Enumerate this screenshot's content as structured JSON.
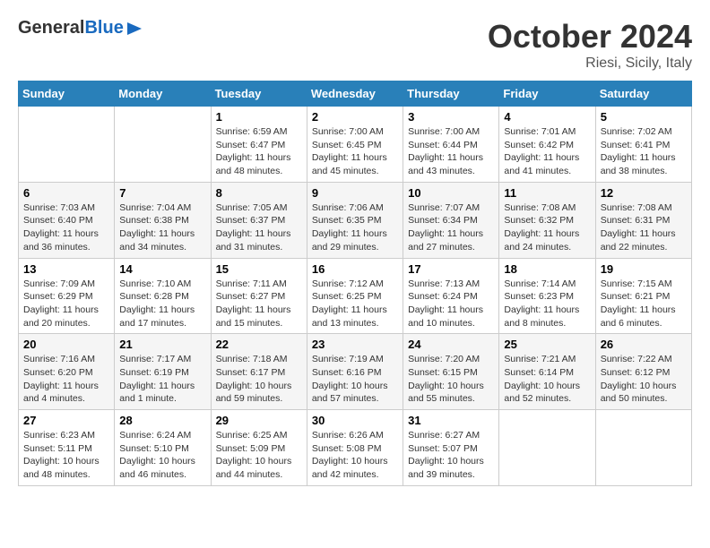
{
  "header": {
    "logo_general": "General",
    "logo_blue": "Blue",
    "month": "October 2024",
    "location": "Riesi, Sicily, Italy"
  },
  "weekdays": [
    "Sunday",
    "Monday",
    "Tuesday",
    "Wednesday",
    "Thursday",
    "Friday",
    "Saturday"
  ],
  "weeks": [
    [
      {
        "day": "",
        "info": ""
      },
      {
        "day": "",
        "info": ""
      },
      {
        "day": "1",
        "info": "Sunrise: 6:59 AM\nSunset: 6:47 PM\nDaylight: 11 hours and 48 minutes."
      },
      {
        "day": "2",
        "info": "Sunrise: 7:00 AM\nSunset: 6:45 PM\nDaylight: 11 hours and 45 minutes."
      },
      {
        "day": "3",
        "info": "Sunrise: 7:00 AM\nSunset: 6:44 PM\nDaylight: 11 hours and 43 minutes."
      },
      {
        "day": "4",
        "info": "Sunrise: 7:01 AM\nSunset: 6:42 PM\nDaylight: 11 hours and 41 minutes."
      },
      {
        "day": "5",
        "info": "Sunrise: 7:02 AM\nSunset: 6:41 PM\nDaylight: 11 hours and 38 minutes."
      }
    ],
    [
      {
        "day": "6",
        "info": "Sunrise: 7:03 AM\nSunset: 6:40 PM\nDaylight: 11 hours and 36 minutes."
      },
      {
        "day": "7",
        "info": "Sunrise: 7:04 AM\nSunset: 6:38 PM\nDaylight: 11 hours and 34 minutes."
      },
      {
        "day": "8",
        "info": "Sunrise: 7:05 AM\nSunset: 6:37 PM\nDaylight: 11 hours and 31 minutes."
      },
      {
        "day": "9",
        "info": "Sunrise: 7:06 AM\nSunset: 6:35 PM\nDaylight: 11 hours and 29 minutes."
      },
      {
        "day": "10",
        "info": "Sunrise: 7:07 AM\nSunset: 6:34 PM\nDaylight: 11 hours and 27 minutes."
      },
      {
        "day": "11",
        "info": "Sunrise: 7:08 AM\nSunset: 6:32 PM\nDaylight: 11 hours and 24 minutes."
      },
      {
        "day": "12",
        "info": "Sunrise: 7:08 AM\nSunset: 6:31 PM\nDaylight: 11 hours and 22 minutes."
      }
    ],
    [
      {
        "day": "13",
        "info": "Sunrise: 7:09 AM\nSunset: 6:29 PM\nDaylight: 11 hours and 20 minutes."
      },
      {
        "day": "14",
        "info": "Sunrise: 7:10 AM\nSunset: 6:28 PM\nDaylight: 11 hours and 17 minutes."
      },
      {
        "day": "15",
        "info": "Sunrise: 7:11 AM\nSunset: 6:27 PM\nDaylight: 11 hours and 15 minutes."
      },
      {
        "day": "16",
        "info": "Sunrise: 7:12 AM\nSunset: 6:25 PM\nDaylight: 11 hours and 13 minutes."
      },
      {
        "day": "17",
        "info": "Sunrise: 7:13 AM\nSunset: 6:24 PM\nDaylight: 11 hours and 10 minutes."
      },
      {
        "day": "18",
        "info": "Sunrise: 7:14 AM\nSunset: 6:23 PM\nDaylight: 11 hours and 8 minutes."
      },
      {
        "day": "19",
        "info": "Sunrise: 7:15 AM\nSunset: 6:21 PM\nDaylight: 11 hours and 6 minutes."
      }
    ],
    [
      {
        "day": "20",
        "info": "Sunrise: 7:16 AM\nSunset: 6:20 PM\nDaylight: 11 hours and 4 minutes."
      },
      {
        "day": "21",
        "info": "Sunrise: 7:17 AM\nSunset: 6:19 PM\nDaylight: 11 hours and 1 minute."
      },
      {
        "day": "22",
        "info": "Sunrise: 7:18 AM\nSunset: 6:17 PM\nDaylight: 10 hours and 59 minutes."
      },
      {
        "day": "23",
        "info": "Sunrise: 7:19 AM\nSunset: 6:16 PM\nDaylight: 10 hours and 57 minutes."
      },
      {
        "day": "24",
        "info": "Sunrise: 7:20 AM\nSunset: 6:15 PM\nDaylight: 10 hours and 55 minutes."
      },
      {
        "day": "25",
        "info": "Sunrise: 7:21 AM\nSunset: 6:14 PM\nDaylight: 10 hours and 52 minutes."
      },
      {
        "day": "26",
        "info": "Sunrise: 7:22 AM\nSunset: 6:12 PM\nDaylight: 10 hours and 50 minutes."
      }
    ],
    [
      {
        "day": "27",
        "info": "Sunrise: 6:23 AM\nSunset: 5:11 PM\nDaylight: 10 hours and 48 minutes."
      },
      {
        "day": "28",
        "info": "Sunrise: 6:24 AM\nSunset: 5:10 PM\nDaylight: 10 hours and 46 minutes."
      },
      {
        "day": "29",
        "info": "Sunrise: 6:25 AM\nSunset: 5:09 PM\nDaylight: 10 hours and 44 minutes."
      },
      {
        "day": "30",
        "info": "Sunrise: 6:26 AM\nSunset: 5:08 PM\nDaylight: 10 hours and 42 minutes."
      },
      {
        "day": "31",
        "info": "Sunrise: 6:27 AM\nSunset: 5:07 PM\nDaylight: 10 hours and 39 minutes."
      },
      {
        "day": "",
        "info": ""
      },
      {
        "day": "",
        "info": ""
      }
    ]
  ]
}
